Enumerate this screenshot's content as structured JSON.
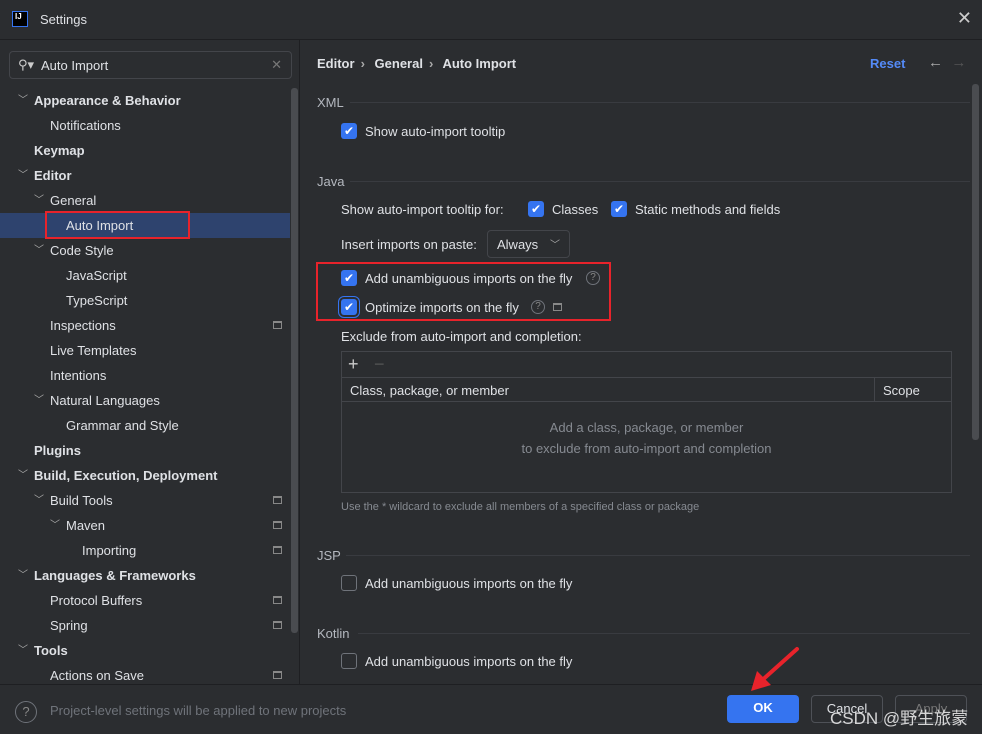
{
  "window": {
    "title": "Settings",
    "logo": "IJ"
  },
  "search": {
    "value": "Auto Import"
  },
  "tree": [
    {
      "label": "Appearance & Behavior",
      "level": 0,
      "bold": true,
      "chev": "open"
    },
    {
      "label": "Notifications",
      "level": 1
    },
    {
      "label": "Keymap",
      "level": 0,
      "bold": true
    },
    {
      "label": "Editor",
      "level": 0,
      "bold": true,
      "chev": "open"
    },
    {
      "label": "General",
      "level": 1,
      "chev": "open"
    },
    {
      "label": "Auto Import",
      "level": 2,
      "selected": true
    },
    {
      "label": "Code Style",
      "level": 1,
      "chev": "open"
    },
    {
      "label": "JavaScript",
      "level": 2
    },
    {
      "label": "TypeScript",
      "level": 2
    },
    {
      "label": "Inspections",
      "level": 1,
      "proj": true
    },
    {
      "label": "Live Templates",
      "level": 1
    },
    {
      "label": "Intentions",
      "level": 1
    },
    {
      "label": "Natural Languages",
      "level": 1,
      "chev": "open"
    },
    {
      "label": "Grammar and Style",
      "level": 2
    },
    {
      "label": "Plugins",
      "level": 0,
      "bold": true
    },
    {
      "label": "Build, Execution, Deployment",
      "level": 0,
      "bold": true,
      "chev": "open"
    },
    {
      "label": "Build Tools",
      "level": 1,
      "chev": "open",
      "proj": true
    },
    {
      "label": "Maven",
      "level": 2,
      "chev": "open",
      "proj": true
    },
    {
      "label": "Importing",
      "level": 3,
      "proj": true
    },
    {
      "label": "Languages & Frameworks",
      "level": 0,
      "bold": true,
      "chev": "open"
    },
    {
      "label": "Protocol Buffers",
      "level": 1,
      "proj": true
    },
    {
      "label": "Spring",
      "level": 1,
      "proj": true
    },
    {
      "label": "Tools",
      "level": 0,
      "bold": true,
      "chev": "open"
    },
    {
      "label": "Actions on Save",
      "level": 1,
      "proj": true
    }
  ],
  "breadcrumb": [
    "Editor",
    "General",
    "Auto Import"
  ],
  "reset": "Reset",
  "xml": {
    "title": "XML",
    "tooltip": "Show auto-import tooltip"
  },
  "java": {
    "title": "Java",
    "tooltip_for": "Show auto-import tooltip for:",
    "classes": "Classes",
    "static": "Static methods and fields",
    "paste_label": "Insert imports on paste:",
    "paste_value": "Always",
    "unambiguous": "Add unambiguous imports on the fly",
    "optimize": "Optimize imports on the fly",
    "exclude_label": "Exclude from auto-import and completion:",
    "col_class": "Class, package, or member",
    "col_scope": "Scope",
    "empty1": "Add a class, package, or member",
    "empty2": "to exclude from auto-import and completion",
    "hint": "Use the * wildcard to exclude all members of a specified class or package"
  },
  "jsp": {
    "title": "JSP",
    "unambiguous": "Add unambiguous imports on the fly"
  },
  "kotlin": {
    "title": "Kotlin",
    "unambiguous": "Add unambiguous imports on the fly"
  },
  "footer": {
    "note": "Project-level settings will be applied to new projects",
    "ok": "OK",
    "cancel": "Cancel",
    "apply": "Apply"
  },
  "watermark": "CSDN @野生旅蒙",
  "colors": {
    "accent": "#3574f0",
    "highlight": "#e8232b",
    "selection": "#2e436e"
  }
}
